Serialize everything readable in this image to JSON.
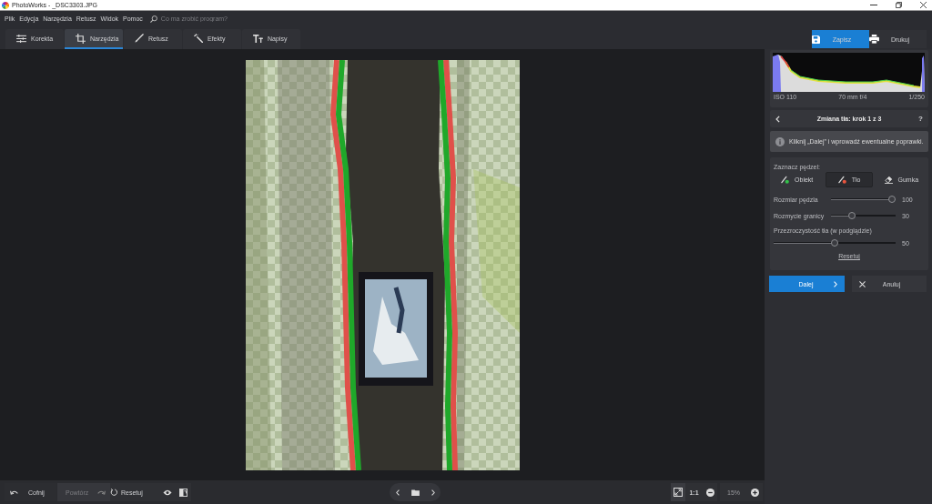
{
  "window": {
    "title": "PhotoWorks - _DSC3303.JPG"
  },
  "menu": [
    "Plik",
    "Edycja",
    "Narzędzia",
    "Retusz",
    "Widok",
    "Pomoc"
  ],
  "search": {
    "placeholder": "Co ma zrobić program?"
  },
  "tabs": [
    {
      "label": "Korekta",
      "selected": false
    },
    {
      "label": "Narzędzia",
      "selected": true
    },
    {
      "label": "Retusz",
      "selected": false
    },
    {
      "label": "Efekty",
      "selected": false
    },
    {
      "label": "Napisy",
      "selected": false
    }
  ],
  "actions": [
    {
      "kind": "save",
      "label": "Zapisz",
      "primary": true
    },
    {
      "kind": "print",
      "label": "Drukuj",
      "primary": false
    }
  ],
  "histogram": {
    "iso": "ISO 110",
    "lens": "70 mm f/4",
    "shutter": "1/250"
  },
  "panel": {
    "title": "Zmiana tła: krok 1 z 3",
    "help": "?",
    "info": "Kliknij „Dalej” i wprowadź ewentualne poprawki.",
    "brush_label": "Zaznacz pędzel:",
    "brushes": [
      {
        "kind": "object",
        "label": "Obiekt",
        "selected": false
      },
      {
        "kind": "background",
        "label": "Tło",
        "selected": true
      },
      {
        "kind": "eraser",
        "label": "Gumka",
        "selected": false
      }
    ],
    "sliders": [
      {
        "kind": "inline",
        "label": "Rozmiar pędzla",
        "level": 1,
        "reading": "100"
      },
      {
        "kind": "inline",
        "label": "Rozmycie granicy",
        "level": 0.3,
        "reading": "30"
      },
      {
        "kind": "stacked",
        "label": "Przezroczystość tła (w podglądzie)",
        "level": 0.5,
        "reading": "50"
      }
    ],
    "reset": "Resetuj",
    "buttons": [
      {
        "kind": "next",
        "label": "Dalej",
        "primary": true
      },
      {
        "kind": "cancel",
        "label": "Anuluj",
        "primary": false
      }
    ]
  },
  "bottom_bar": {
    "history": [
      {
        "kind": "undo",
        "label": "Cofnij",
        "disabled": false
      },
      {
        "kind": "redo",
        "label": "Powtórz",
        "disabled": true
      }
    ],
    "reset": "Resetuj",
    "actual_size": "1:1",
    "zoom": "15%"
  }
}
